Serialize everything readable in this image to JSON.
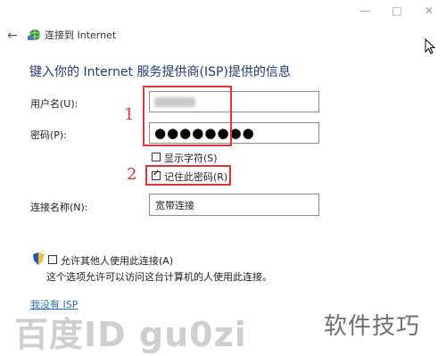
{
  "window": {
    "title": "连接到 Internet",
    "controls": {
      "minimize": "—",
      "maximize": "□",
      "close": "✕"
    }
  },
  "heading": "键入你的 Internet 服务提供商(ISP)提供的信息",
  "form": {
    "username_label": "用户名(U):",
    "username_value": "",
    "password_label": "密码(P):",
    "password_value": "●●●●●●●●",
    "show_chars_label": "显示字符(S)",
    "show_chars_checked": false,
    "remember_label": "记住此密码(R)",
    "remember_checked": true,
    "conn_name_label": "连接名称(N):",
    "conn_name_value": "宽带连接",
    "allow_others_label": "允许其他人使用此连接(A)",
    "allow_others_checked": false,
    "allow_others_desc": "这个选项允许可以访问这台计算机的人使用此连接。",
    "no_isp_link": "我没有 ISP"
  },
  "annotations": {
    "marker_1": "1",
    "marker_2": "2"
  },
  "watermark": {
    "left": "百度ID gu0zi",
    "right": "软件技巧"
  },
  "colors": {
    "heading": "#1e3d7a",
    "annotation": "#e1333c",
    "link": "#2a6ec9"
  }
}
